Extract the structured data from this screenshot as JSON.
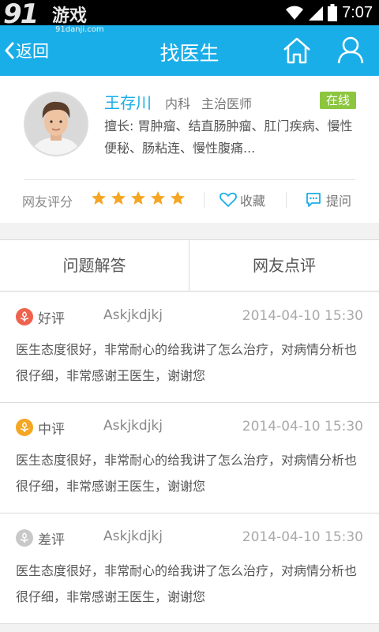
{
  "status_bar": {
    "time": "7:07"
  },
  "watermark": {
    "brand": "91",
    "game_text": "游戏",
    "url": "91danji.com"
  },
  "header": {
    "back_label": "返回",
    "title": "找医生"
  },
  "doctor": {
    "name": "王存川",
    "department": "内科",
    "title": "主治医师",
    "status": "在线",
    "specialty": "擅长: 胃肿瘤、结直肠肿瘤、肛门疾病、慢性便秘、肠粘连、慢性腹痛...",
    "rating_label": "网友评分",
    "rating_stars": 5,
    "rating_max": 5,
    "favorite_label": "收藏",
    "ask_label": "提问"
  },
  "tabs": [
    {
      "label": "问题解答",
      "selected": false
    },
    {
      "label": "网友点评",
      "selected": true
    }
  ],
  "reviews": [
    {
      "type": "好评",
      "type_color": "#f0624d",
      "user": "Askjkdjkj",
      "time": "2014-04-10  15:30",
      "text": "医生态度很好，非常耐心的给我讲了怎么治疗，对病情分析也很仔细，非常感谢王医生，谢谢您"
    },
    {
      "type": "中评",
      "type_color": "#f5a623",
      "user": "Askjkdjkj",
      "time": "2014-04-10  15:30",
      "text": "医生态度很好，非常耐心的给我讲了怎么治疗，对病情分析也很仔细，非常感谢王医生，谢谢您"
    },
    {
      "type": "差评",
      "type_color": "#c8c8c8",
      "user": "Askjkdjkj",
      "time": "2014-04-10  15:30",
      "text": "医生态度很好，非常耐心的给我讲了怎么治疗，对病情分析也很仔细，非常感谢王医生，谢谢您"
    }
  ],
  "colors": {
    "accent": "#1aaee8",
    "online": "#8cc63f",
    "star": "#f5a623"
  }
}
